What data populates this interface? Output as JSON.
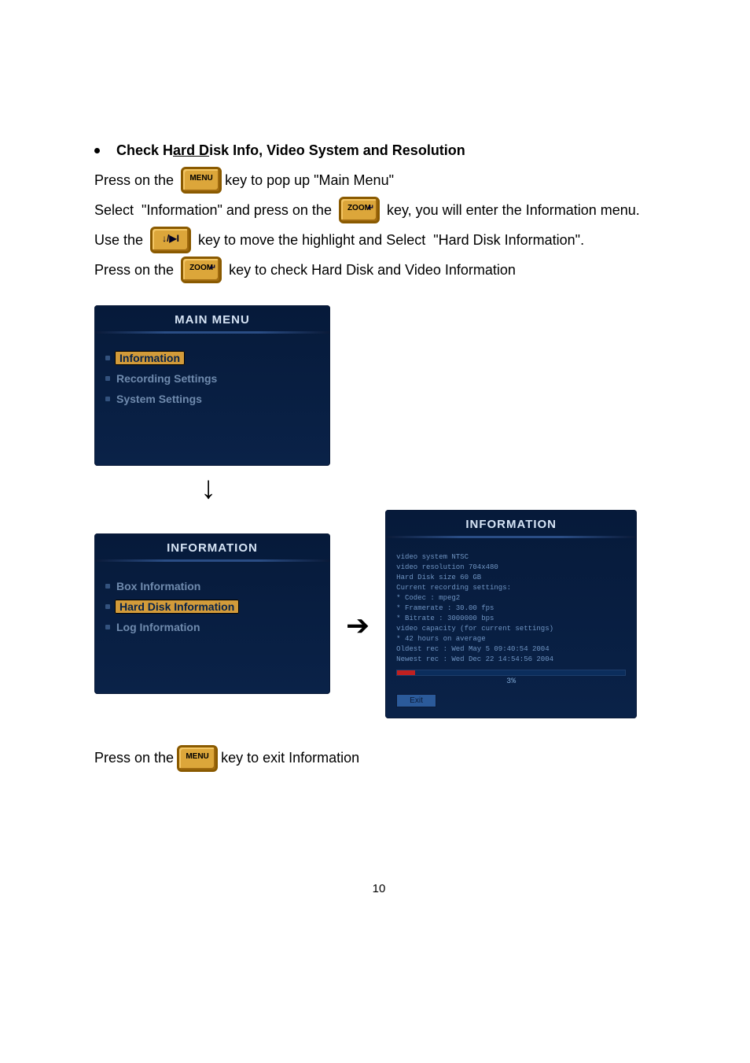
{
  "heading": {
    "part1": "Check H",
    "underlined": "ard D",
    "part2": "isk Info, Video System and Resolution"
  },
  "lines": {
    "l1a": "Press on the ",
    "l1b": "key to pop up \"Main Menu\"",
    "l2a": "Select  \"Information\" and press on the ",
    "l2b": " key, you will enter the Information menu.",
    "l3a": "Use the ",
    "l3b": " key to move the highlight and Select  \"Hard Disk Information\".",
    "l4a": "Press on the ",
    "l4b": " key to check Hard Disk and Video Information"
  },
  "keys": {
    "menu": "MENU",
    "zoom": "ZOOM",
    "nav": "↓/▶I"
  },
  "main_menu": {
    "title": "MAIN MENU",
    "items": [
      {
        "label": "Information",
        "selected": true
      },
      {
        "label": "Recording Settings",
        "selected": false
      },
      {
        "label": "System Settings",
        "selected": false
      }
    ]
  },
  "info_menu": {
    "title": "INFORMATION",
    "items": [
      {
        "label": "Box Information",
        "selected": false
      },
      {
        "label": "Hard Disk Information",
        "selected": true
      },
      {
        "label": "Log Information",
        "selected": false
      }
    ]
  },
  "info_detail": {
    "title": "INFORMATION",
    "lines": [
      "video system NTSC",
      "video resolution 704x480",
      "Hard Disk size 60 GB",
      "Current recording settings:",
      "*  Codec     : mpeg2",
      "*  Framerate : 30.00 fps",
      "*  Bitrate   : 3000000 bps",
      "video capacity (for current settings)",
      "*  42 hours on average",
      "Oldest rec : Wed May  5 09:40:54 2004",
      "Newest rec : Wed Dec 22 14:54:56 2004"
    ],
    "progress_pct": "3%",
    "exit_label": "Exit"
  },
  "footer": {
    "a": "Press on the ",
    "b": "key to exit Information"
  },
  "page_number": "10"
}
